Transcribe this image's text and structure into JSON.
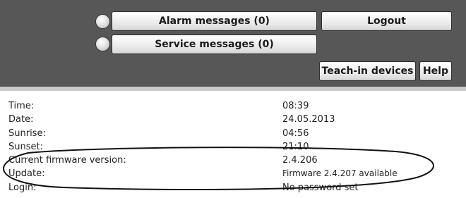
{
  "toolbar": {
    "alarm_label": "Alarm messages (0)",
    "service_label": "Service messages (0)",
    "logout_label": "Logout",
    "teach_in_label": "Teach-in devices",
    "help_label": "Help"
  },
  "info": {
    "rows": [
      {
        "label": "Time:",
        "value": "08:39"
      },
      {
        "label": "Date:",
        "value": "24.05.2013"
      },
      {
        "label": "Sunrise:",
        "value": "04:56"
      },
      {
        "label": "Sunset:",
        "value": "21:10"
      },
      {
        "label": "Current firmware version:",
        "value": "2.4.206"
      },
      {
        "label": "Update:",
        "value": "Firmware 2.4.207 available"
      },
      {
        "label": "Login:",
        "value": "No password set"
      }
    ]
  }
}
